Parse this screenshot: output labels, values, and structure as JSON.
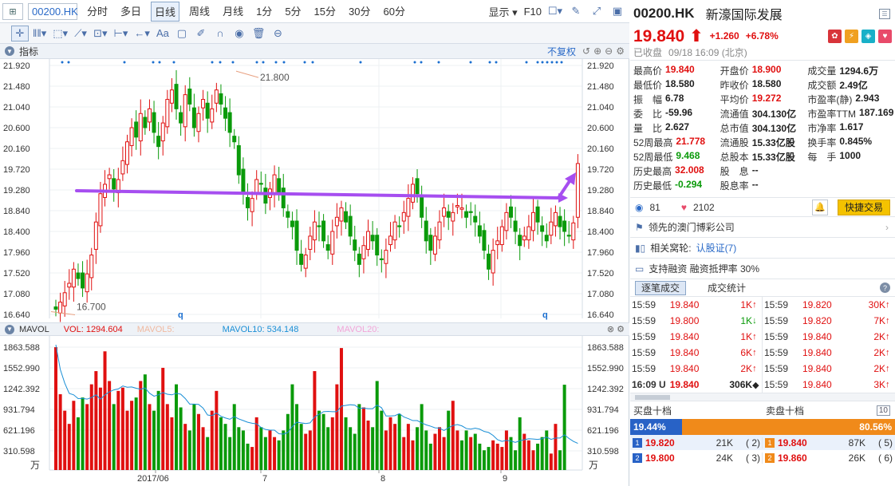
{
  "header": {
    "code": "00200.HK",
    "periods": [
      "分时",
      "多日",
      "日线",
      "周线",
      "月线",
      "1分",
      "5分",
      "15分",
      "30分",
      "60分"
    ],
    "active": "日线",
    "display": "显示",
    "f10": "F10"
  },
  "toolbar": {
    "text_tool": "Aa"
  },
  "indicator": {
    "title": "指标",
    "adj": "不复权"
  },
  "price_axis": [
    "21.920",
    "21.480",
    "21.040",
    "20.600",
    "20.160",
    "19.720",
    "19.280",
    "18.840",
    "18.400",
    "17.960",
    "17.520",
    "17.080",
    "16.640"
  ],
  "annotations": {
    "high": "21.800",
    "low": "16.700",
    "q": "q"
  },
  "mavol": {
    "title": "MAVOL",
    "vol": "VOL: 1294.604",
    "ma5": "MAVOL5:",
    "ma10": "MAVOL10: 534.148",
    "ma20": "MAVOL20:",
    "unit": "万"
  },
  "vol_axis": [
    "1863.588",
    "1552.990",
    "1242.392",
    "931.794",
    "621.196",
    "310.598"
  ],
  "date_axis": [
    "2017/06",
    "7",
    "8",
    "9"
  ],
  "quote": {
    "code": "00200.HK",
    "name": "新濠国际发展",
    "price": "19.840",
    "change": "+1.260",
    "pct": "+6.78%",
    "status": "已收盘",
    "time": "09/18 16:09 (北京)",
    "rows": [
      [
        [
          "最高价",
          "19.840",
          "red"
        ],
        [
          "开盘价",
          "18.900",
          "red"
        ],
        [
          "成交量",
          "1294.6万",
          "blk"
        ]
      ],
      [
        [
          "最低价",
          "18.580",
          "blk"
        ],
        [
          "昨收价",
          "18.580",
          "blk"
        ],
        [
          "成交额",
          "2.49亿",
          "blk"
        ]
      ],
      [
        [
          "振　幅",
          "6.78",
          "blk"
        ],
        [
          "平均价",
          "19.272",
          "red"
        ],
        [
          "市盈率(静)",
          "2.943",
          "blk"
        ]
      ],
      [
        [
          "委　比",
          "-59.96",
          "blk"
        ],
        [
          "流通值",
          "304.130亿",
          "blk"
        ],
        [
          "市盈率TTM",
          "187.169",
          "blk"
        ]
      ],
      [
        [
          "量　比",
          "2.627",
          "blk"
        ],
        [
          "总市值",
          "304.130亿",
          "blk"
        ],
        [
          "市净率",
          "1.617",
          "blk"
        ]
      ],
      [
        [
          "52周最高",
          "21.778",
          "red"
        ],
        [
          "流通股",
          "15.33亿股",
          "blk"
        ],
        [
          "换手率",
          "0.845%",
          "blk"
        ]
      ],
      [
        [
          "52周最低",
          "9.468",
          "green"
        ],
        [
          "总股本",
          "15.33亿股",
          "blk"
        ],
        [
          "每　手",
          "1000",
          "blk"
        ]
      ],
      [
        [
          "历史最高",
          "32.008",
          "red"
        ],
        [
          "股　息",
          "--",
          "blk"
        ],
        [
          "",
          "",
          ""
        ]
      ],
      [
        [
          "历史最低",
          "-0.294",
          "green"
        ],
        [
          "股息率",
          "--",
          "blk"
        ],
        [
          "",
          "",
          ""
        ]
      ]
    ]
  },
  "social": {
    "views": "81",
    "likes": "2102",
    "quick_trade": "快捷交易"
  },
  "info": {
    "company": "领先的澳门博彩公司",
    "warrants_label": "相关窝轮:",
    "warrants": "认股证(7)",
    "margin": "支持融资  融资抵押率 30%"
  },
  "tabs": [
    "逐笔成交",
    "成交统计"
  ],
  "trades_left": [
    [
      "15:59",
      "19.840",
      "1K",
      "↑",
      "red"
    ],
    [
      "15:59",
      "19.800",
      "1K",
      "↓",
      "green"
    ],
    [
      "15:59",
      "19.840",
      "1K",
      "↑",
      "red"
    ],
    [
      "15:59",
      "19.840",
      "6K",
      "↑",
      "red"
    ],
    [
      "15:59",
      "19.840",
      "2K",
      "↑",
      "red"
    ],
    [
      "16:09 U",
      "19.840",
      "306K",
      "◆",
      "blk"
    ]
  ],
  "trades_right": [
    [
      "15:59",
      "19.820",
      "30K",
      "↑",
      "red"
    ],
    [
      "15:59",
      "19.820",
      "7K",
      "↑",
      "red"
    ],
    [
      "15:59",
      "19.840",
      "2K",
      "↑",
      "red"
    ],
    [
      "15:59",
      "19.840",
      "2K",
      "↑",
      "red"
    ],
    [
      "15:59",
      "19.840",
      "2K",
      "↑",
      "red"
    ],
    [
      "15:59",
      "19.840",
      "3K",
      "↑",
      "red"
    ]
  ],
  "orderbook": {
    "buy_title": "买盘十档",
    "sell_title": "卖盘十档",
    "count": "10",
    "buy_pct": "19.44%",
    "sell_pct": "80.56%",
    "rows": [
      [
        [
          "1",
          "19.820",
          "21K",
          "( 2)"
        ],
        [
          "1",
          "19.840",
          "87K",
          "( 5)"
        ]
      ],
      [
        [
          "2",
          "19.800",
          "24K",
          "( 3)"
        ],
        [
          "2",
          "19.860",
          "26K",
          "( 6)"
        ]
      ]
    ]
  }
}
